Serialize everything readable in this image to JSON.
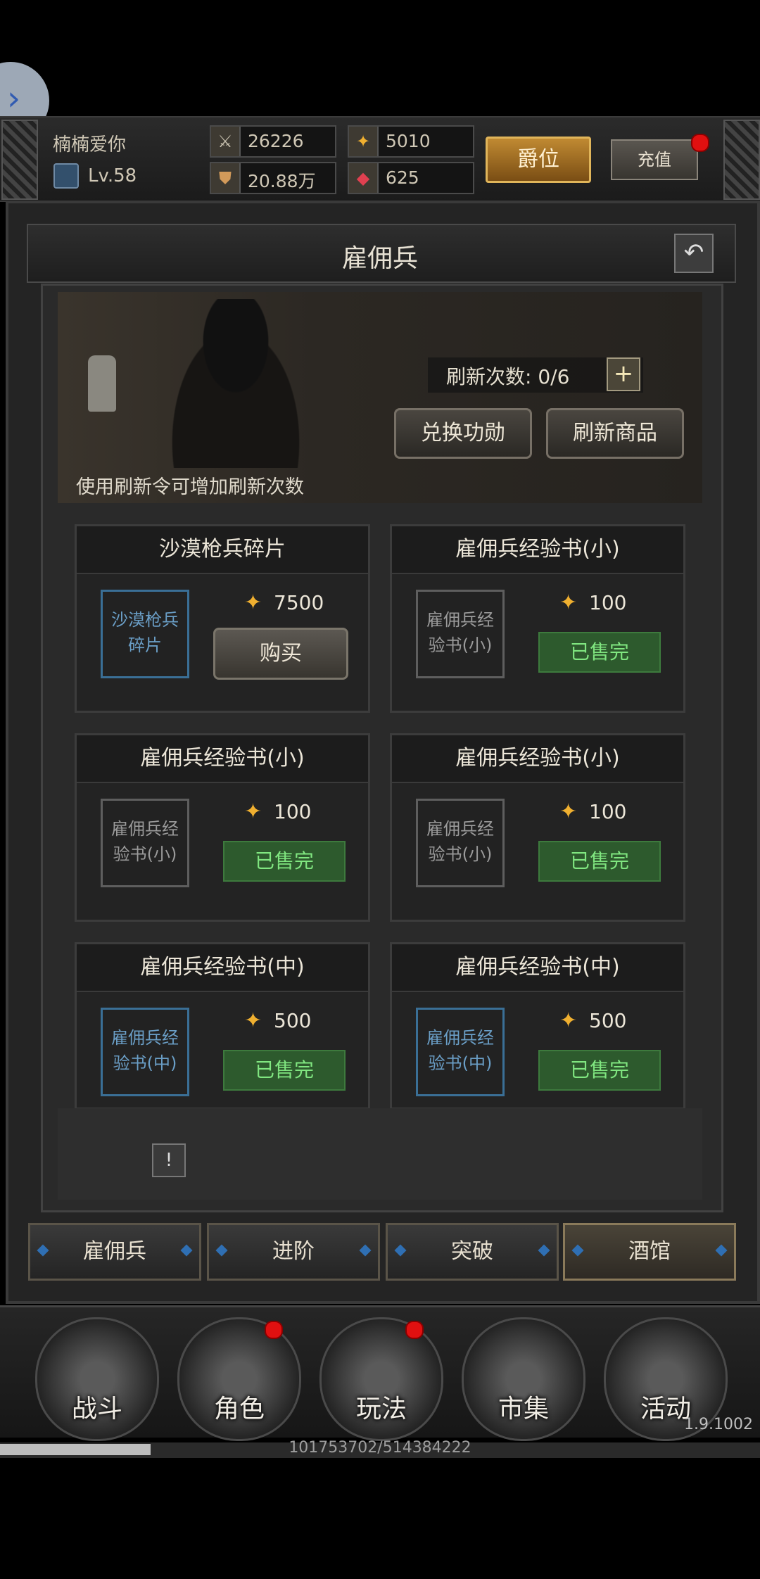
{
  "player": {
    "name": "楠楠爱你",
    "level": "Lv.58"
  },
  "stats": {
    "power": "26226",
    "gold": "5010",
    "food": "20.88万",
    "gems": "625"
  },
  "header_buttons": {
    "rank": "爵位",
    "recharge": "充值"
  },
  "page_title": "雇佣兵",
  "banner": {
    "refresh_label": "刷新次数: 0/6",
    "plus": "+",
    "exchange_button": "兑换功勋",
    "refresh_button": "刷新商品",
    "hint": "使用刷新令可增加刷新次数"
  },
  "items": [
    {
      "title": "沙漠枪兵碎片",
      "thumb": "沙漠枪兵碎片",
      "price": "7500",
      "action": "购买",
      "sold": false,
      "rare": true
    },
    {
      "title": "雇佣兵经验书(小)",
      "thumb": "雇佣兵经验书(小)",
      "price": "100",
      "action": "已售完",
      "sold": true,
      "rare": false
    },
    {
      "title": "雇佣兵经验书(小)",
      "thumb": "雇佣兵经验书(小)",
      "price": "100",
      "action": "已售完",
      "sold": true,
      "rare": false
    },
    {
      "title": "雇佣兵经验书(小)",
      "thumb": "雇佣兵经验书(小)",
      "price": "100",
      "action": "已售完",
      "sold": true,
      "rare": false
    },
    {
      "title": "雇佣兵经验书(中)",
      "thumb": "雇佣兵经验书(中)",
      "price": "500",
      "action": "已售完",
      "sold": true,
      "rare": true
    },
    {
      "title": "雇佣兵经验书(中)",
      "thumb": "雇佣兵经验书(中)",
      "price": "500",
      "action": "已售完",
      "sold": true,
      "rare": true
    }
  ],
  "info_icon": "!",
  "sub_tabs": [
    "雇佣兵",
    "进阶",
    "突破",
    "酒馆"
  ],
  "active_sub_tab": "酒馆",
  "nav": [
    {
      "label": "战斗",
      "badge": false
    },
    {
      "label": "角色",
      "badge": true
    },
    {
      "label": "玩法",
      "badge": true
    },
    {
      "label": "市集",
      "badge": false
    },
    {
      "label": "活动",
      "badge": false
    }
  ],
  "version": "1.9.1002",
  "progress": {
    "text": "101753702/514384222",
    "fraction": 0.198
  },
  "colors": {
    "gold_accent": "#f0b030",
    "sold_green": "#80e680",
    "rare_border": "#3a6f96",
    "badge_red": "#e01010"
  },
  "icons": {
    "side_tab": "chevron-right-icon",
    "back": "return-icon",
    "price": "gold-coin-icon"
  }
}
